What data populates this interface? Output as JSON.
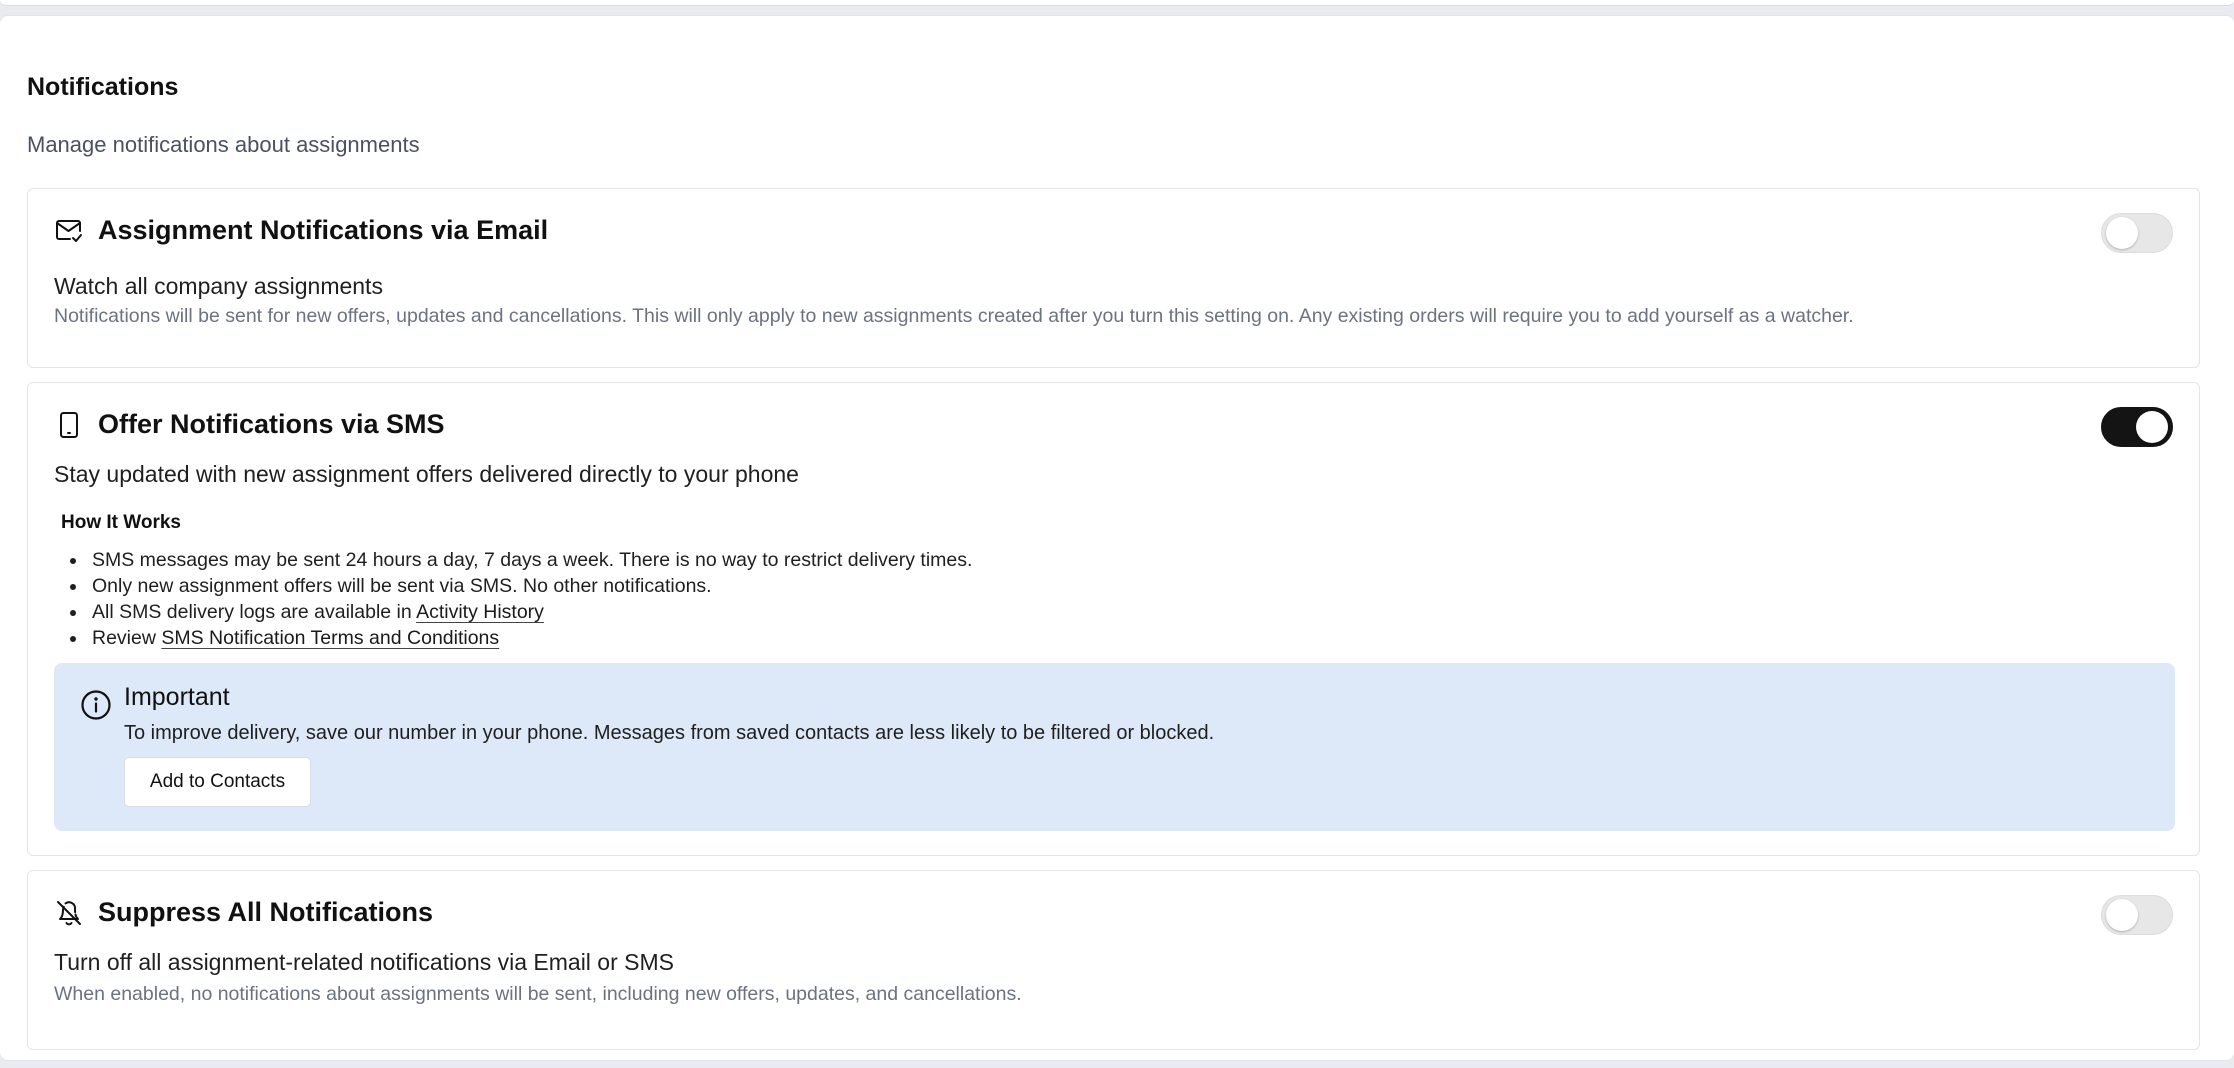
{
  "section": {
    "title": "Notifications",
    "subtitle": "Manage notifications about assignments"
  },
  "email_card": {
    "icon": "mail-check-icon",
    "title": "Assignment Notifications via Email",
    "description": "Watch all company assignments",
    "note": "Notifications will be sent for new offers, updates and cancellations. This will only apply to new assignments created after you turn this setting on. Any existing orders will require you to add yourself as a watcher.",
    "enabled": false
  },
  "sms_card": {
    "icon": "smartphone-icon",
    "title": "Offer Notifications via SMS",
    "description": "Stay updated with new assignment offers delivered directly to your phone",
    "enabled": true,
    "how_it_works": {
      "title": "How It Works",
      "items": [
        "SMS messages may be sent 24 hours a day, 7 days a week. There is no way to restrict delivery times.",
        "Only new assignment offers will be sent via SMS. No other notifications."
      ],
      "logs_prefix": "All SMS delivery logs are available in ",
      "logs_link": "Activity History",
      "review_prefix": "Review ",
      "review_link": "SMS Notification Terms and Conditions"
    },
    "alert": {
      "icon": "info-icon",
      "title": "Important",
      "text": "To improve delivery, save our number in your phone. Messages from saved contacts are less likely to be filtered or blocked.",
      "button_label": "Add to Contacts",
      "background": "#dde8f8"
    }
  },
  "suppress_card": {
    "icon": "bell-off-icon",
    "title": "Suppress All Notifications",
    "description": "Turn off all assignment-related notifications via Email or SMS",
    "note": "When enabled, no notifications about assignments will be sent, including new offers, updates, and cancellations.",
    "enabled": false
  },
  "colors": {
    "toggle_on": "#141414",
    "toggle_off": "#e7e7e7",
    "muted_text": "#6b7280"
  }
}
